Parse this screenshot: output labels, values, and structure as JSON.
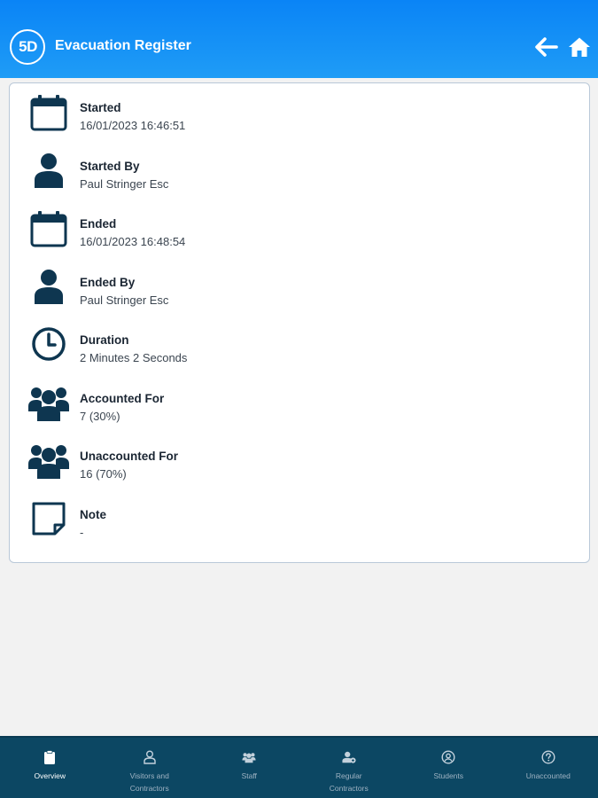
{
  "header": {
    "title": "Evacuation Register",
    "logo_text": "5D",
    "logo_small_top": "",
    "logo_small_bottom": ""
  },
  "colors": {
    "header_top": "#0a84f6",
    "header_bottom": "#1f9cf6",
    "icon_dark": "#0e3650",
    "nav_background": "#0c4763"
  },
  "details": [
    {
      "label": "Started",
      "value": "16/01/2023 16:46:51",
      "icon": "calendar-icon"
    },
    {
      "label": "Started By",
      "value": "Paul Stringer Esc",
      "icon": "person-icon"
    },
    {
      "label": "Ended",
      "value": "16/01/2023 16:48:54",
      "icon": "calendar-icon"
    },
    {
      "label": "Ended By",
      "value": "Paul Stringer Esc",
      "icon": "person-icon"
    },
    {
      "label": "Duration",
      "value": "2 Minutes 2 Seconds",
      "icon": "clock-icon"
    },
    {
      "label": "Accounted For",
      "value": "7 (30%)",
      "icon": "group-icon"
    },
    {
      "label": "Unaccounted For",
      "value": "16 (70%)",
      "icon": "group-icon"
    },
    {
      "label": "Note",
      "value": "-",
      "icon": "note-icon"
    }
  ],
  "nav": [
    {
      "label": "Overview",
      "icon": "clipboard-icon",
      "active": true
    },
    {
      "label": "Visitors and\nContractors",
      "icon": "person-outline-icon",
      "active": false
    },
    {
      "label": "Staff",
      "icon": "group-icon",
      "active": false
    },
    {
      "label": "Regular\nContractors",
      "icon": "person-badge-icon",
      "active": false
    },
    {
      "label": "Students",
      "icon": "student-icon",
      "active": false
    },
    {
      "label": "Unaccounted",
      "icon": "question-circle-icon",
      "active": false
    }
  ]
}
